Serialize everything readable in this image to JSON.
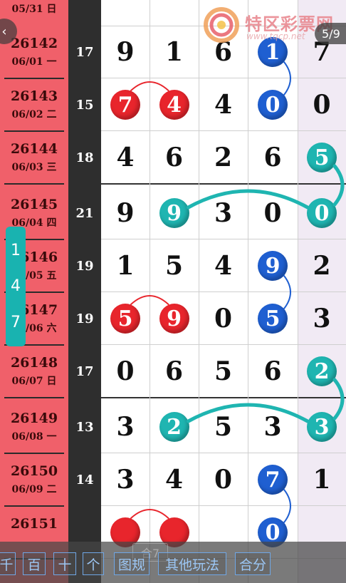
{
  "header": {
    "logo_text": "特区彩票网",
    "logo_url": "www.tqcp.net",
    "back_icon": "chevron-left-icon",
    "page_counter": "5/9"
  },
  "side_tab": {
    "digits": [
      "1",
      "4",
      "7"
    ]
  },
  "top_partial_row": {
    "issue_date": "05/31 日"
  },
  "rows": [
    {
      "issue": "26142",
      "date": "06/01 一",
      "sum": "17",
      "cells": [
        {
          "v": "9",
          "s": "plain"
        },
        {
          "v": "1",
          "s": "plain"
        },
        {
          "v": "6",
          "s": "plain"
        },
        {
          "v": "1",
          "s": "blue"
        },
        {
          "v": "7",
          "s": "plain"
        }
      ]
    },
    {
      "issue": "26143",
      "date": "06/02 二",
      "sum": "15",
      "cells": [
        {
          "v": "7",
          "s": "red"
        },
        {
          "v": "4",
          "s": "red"
        },
        {
          "v": "4",
          "s": "plain"
        },
        {
          "v": "0",
          "s": "blue"
        },
        {
          "v": "0",
          "s": "plain"
        }
      ]
    },
    {
      "issue": "26144",
      "date": "06/03 三",
      "sum": "18",
      "cells": [
        {
          "v": "4",
          "s": "plain"
        },
        {
          "v": "6",
          "s": "plain"
        },
        {
          "v": "2",
          "s": "plain"
        },
        {
          "v": "6",
          "s": "plain"
        },
        {
          "v": "5",
          "s": "teal"
        }
      ]
    },
    {
      "issue": "26145",
      "date": "06/04 四",
      "sum": "21",
      "cells": [
        {
          "v": "9",
          "s": "plain"
        },
        {
          "v": "9",
          "s": "teal"
        },
        {
          "v": "3",
          "s": "plain"
        },
        {
          "v": "0",
          "s": "plain"
        },
        {
          "v": "0",
          "s": "teal"
        }
      ]
    },
    {
      "issue": "26146",
      "date": "06/05 五",
      "sum": "19",
      "cells": [
        {
          "v": "1",
          "s": "plain"
        },
        {
          "v": "5",
          "s": "plain"
        },
        {
          "v": "4",
          "s": "plain"
        },
        {
          "v": "9",
          "s": "blue"
        },
        {
          "v": "2",
          "s": "plain"
        }
      ]
    },
    {
      "issue": "26147",
      "date": "06/06 六",
      "sum": "19",
      "cells": [
        {
          "v": "5",
          "s": "red"
        },
        {
          "v": "9",
          "s": "red"
        },
        {
          "v": "0",
          "s": "plain"
        },
        {
          "v": "5",
          "s": "blue"
        },
        {
          "v": "3",
          "s": "plain"
        }
      ]
    },
    {
      "issue": "26148",
      "date": "06/07 日",
      "sum": "17",
      "cells": [
        {
          "v": "0",
          "s": "plain"
        },
        {
          "v": "6",
          "s": "plain"
        },
        {
          "v": "5",
          "s": "plain"
        },
        {
          "v": "6",
          "s": "plain"
        },
        {
          "v": "2",
          "s": "teal"
        }
      ]
    },
    {
      "issue": "26149",
      "date": "06/08 一",
      "sum": "13",
      "cells": [
        {
          "v": "3",
          "s": "plain"
        },
        {
          "v": "2",
          "s": "teal"
        },
        {
          "v": "5",
          "s": "plain"
        },
        {
          "v": "3",
          "s": "plain"
        },
        {
          "v": "3",
          "s": "teal"
        }
      ]
    },
    {
      "issue": "26150",
      "date": "06/09 二",
      "sum": "14",
      "cells": [
        {
          "v": "3",
          "s": "plain"
        },
        {
          "v": "4",
          "s": "plain"
        },
        {
          "v": "0",
          "s": "plain"
        },
        {
          "v": "7",
          "s": "blue"
        },
        {
          "v": "1",
          "s": "plain"
        }
      ]
    },
    {
      "issue": "26151",
      "date": "",
      "sum": "",
      "cells": [
        {
          "v": "",
          "s": "red"
        },
        {
          "v": "",
          "s": "red"
        },
        {
          "v": "",
          "s": "plain"
        },
        {
          "v": "0",
          "s": "blue"
        },
        {
          "v": "",
          "s": "plain"
        }
      ]
    }
  ],
  "toolbar": {
    "ghost_label": "合7",
    "tabs": [
      "千",
      "百",
      "十",
      "个",
      "图规",
      "其他玩法",
      "合分"
    ]
  },
  "colors": {
    "red_ball": "#e8252c",
    "blue_ball": "#1f5fd1",
    "teal_ball": "#1fb5b1",
    "issue_bg": "#f0606a"
  }
}
